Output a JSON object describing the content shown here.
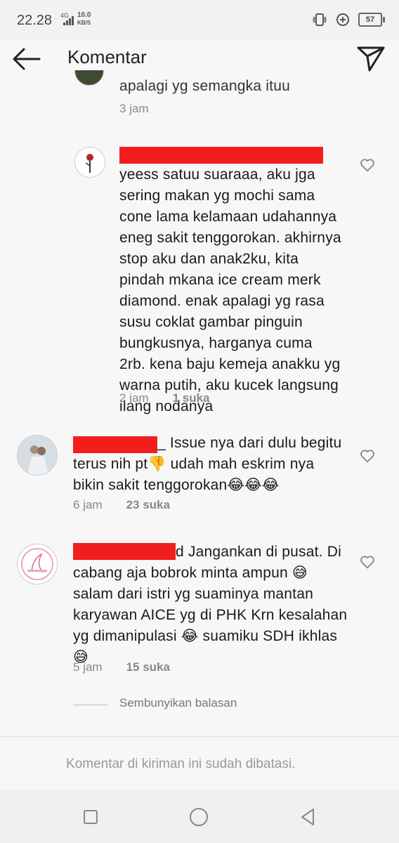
{
  "status": {
    "time": "22.28",
    "network": "4G",
    "speed_value": "10.0",
    "speed_unit": "KB/S",
    "battery": "57"
  },
  "header": {
    "title": "Komentar"
  },
  "comments": [
    {
      "text": "apalagi yg semangka ituu",
      "time": "3 jam"
    },
    {
      "text_lines": [
        "yeess satuu suaraaa, aku jga",
        "sering makan yg mochi sama",
        "cone lama kelamaan udahannya",
        "eneg sakit tenggorokan. akhirnya",
        "stop aku dan anak2ku, kita",
        "pindah mkana ice cream merk",
        "diamond. enak apalagi yg rasa",
        "susu coklat gambar pinguin",
        "bungkusnya, harganya cuma",
        "2rb. kena baju kemeja anakku yg",
        "warna putih, aku kucek langsung",
        "ilang nodanya"
      ],
      "time": "2 jam",
      "likes": "1 suka"
    },
    {
      "line1": "_ Issue nya dari dulu begitu",
      "line2": "terus nih pt👎 udah mah eskrim nya",
      "line3": "bikin sakit tenggorokan😂😂😂",
      "time": "6 jam",
      "likes": "23 suka"
    },
    {
      "line1": "d Jangankan di pusat. Di",
      "line2": "cabang aja bobrok minta ampun 😅",
      "line3": "salam dari istri yg suaminya mantan",
      "line4": "karyawan AICE yg di PHK Krn kesalahan",
      "line5": "yg dimanipulasi 😂 suamiku SDH ikhlas",
      "line6": "😅",
      "time": "5 jam",
      "likes": "15 suka"
    }
  ],
  "hide_replies": "Sembunyikan balasan",
  "restricted_note": "Komentar di kiriman ini sudah dibatasi.",
  "colors": {
    "redaction": "#f21e1e",
    "background": "#f7f7f7"
  }
}
